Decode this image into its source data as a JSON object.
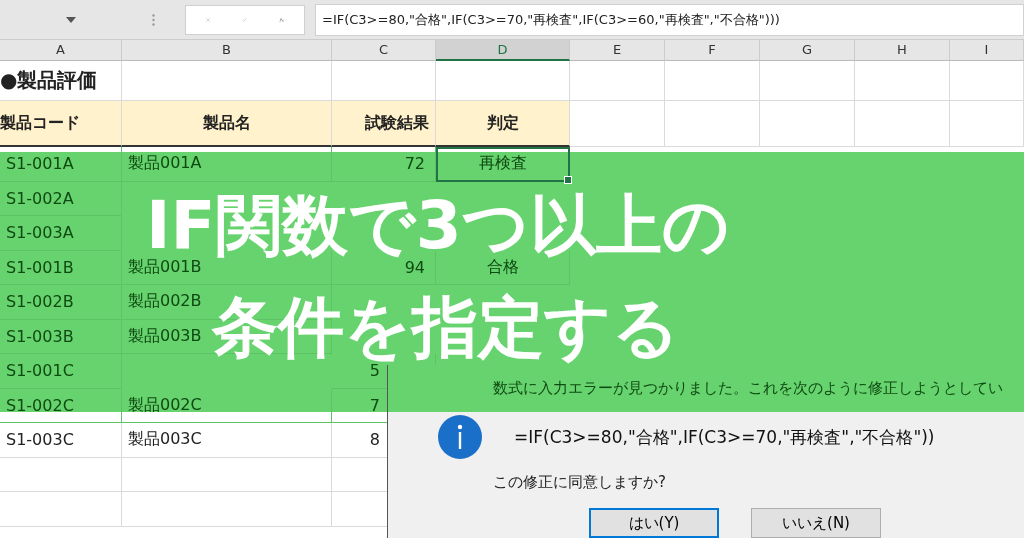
{
  "formula_bar": {
    "formula": "=IF(C3>=80,\"合格\",IF(C3>=70,\"再検査\",IF(C3>=60,\"再検査\",\"不合格\")))"
  },
  "columns": [
    {
      "label": "A",
      "selected": false
    },
    {
      "label": "B",
      "selected": false
    },
    {
      "label": "C",
      "selected": false
    },
    {
      "label": "D",
      "selected": true
    },
    {
      "label": "E",
      "selected": false
    },
    {
      "label": "F",
      "selected": false
    },
    {
      "label": "G",
      "selected": false
    },
    {
      "label": "H",
      "selected": false
    },
    {
      "label": "I",
      "selected": false
    }
  ],
  "sheet_title": "●製品評価",
  "table_header": [
    "製品コード",
    "製品名",
    "試験結果",
    "判定"
  ],
  "rows": [
    {
      "code": "S1-001A",
      "name": "製品001A",
      "result": "72",
      "judgement": "再検査",
      "selected": true
    },
    {
      "code": "S1-002A",
      "selected": false
    },
    {
      "code": "S1-003A",
      "selected": false
    },
    {
      "code": "S1-001B",
      "name": "製品001B",
      "result": "94",
      "judgement": "合格",
      "selected": false
    },
    {
      "code": "S1-002B",
      "name": "製品002B",
      "selected": false
    },
    {
      "code": "S1-003B",
      "name": "製品003B",
      "selected": false
    },
    {
      "code": "S1-001C",
      "result": "5",
      "selected": false
    },
    {
      "code": "S1-002C",
      "name": "製品002C",
      "result": "7"
    },
    {
      "code": "S1-003C",
      "name": "製品003C",
      "result": "8"
    }
  ],
  "dialog": {
    "message": "数式に入力エラーが見つかりました。これを次のように修正しようとしてい",
    "formula": "=IF(C3>=80,\"合格\",IF(C3>=70,\"再検査\",\"不合格\"))",
    "question": "この修正に同意しますか?",
    "buttons": [
      {
        "label": "はい(Y)",
        "default": true
      },
      {
        "label": "いいえ(N)",
        "default": false
      }
    ]
  },
  "banner": {
    "title_lines": [
      "IF関数で3つ以上の",
      "条件を指定する"
    ]
  }
}
